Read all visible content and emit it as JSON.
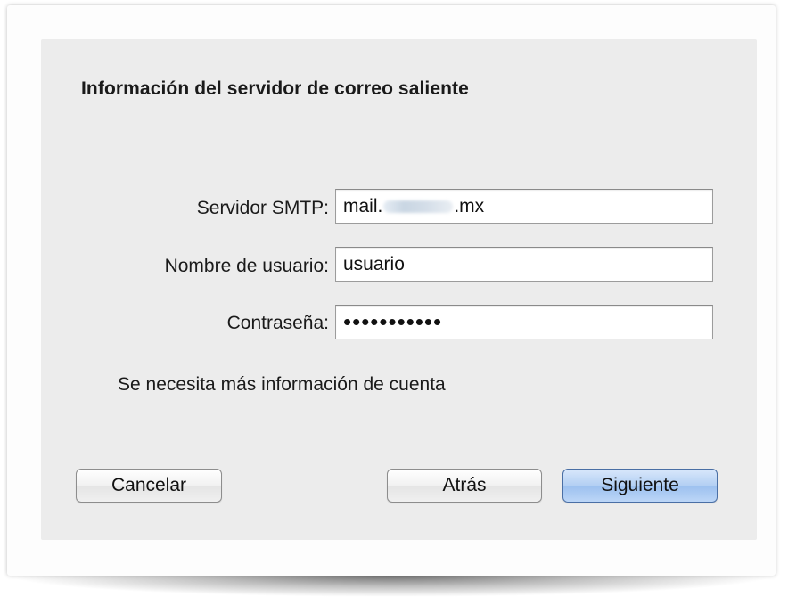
{
  "dialog": {
    "title": "Información del servidor de correo saliente",
    "fields": {
      "smtp_server": {
        "label": "Servidor SMTP:",
        "value_prefix": "mail.",
        "value_redacted_segment": "aplika",
        "value_suffix": ".mx"
      },
      "username": {
        "label": "Nombre de usuario:",
        "value": "usuario"
      },
      "password": {
        "label": "Contraseña:",
        "value": "•••••••••••"
      }
    },
    "info_message": "Se necesita más información de cuenta",
    "buttons": {
      "cancel": "Cancelar",
      "back": "Atrás",
      "next": "Siguiente"
    }
  },
  "colors": {
    "dialog_background": "#ececec",
    "primary_button": "#aecbf2",
    "input_border": "#9c9c9c"
  }
}
